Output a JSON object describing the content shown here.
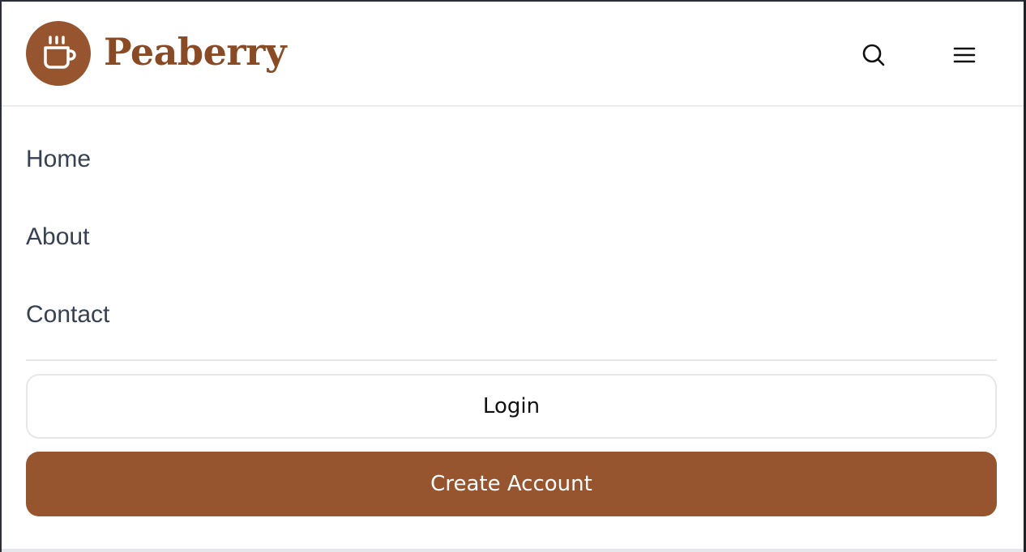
{
  "colors": {
    "brand": "#96552f",
    "brand_text": "#8a4a24",
    "nav_text": "#374151",
    "divider": "#e5e7eb"
  },
  "header": {
    "logo_icon": "coffee-cup-icon",
    "brand_name": "Peaberry",
    "search_icon": "search-icon",
    "menu_icon": "hamburger-menu-icon"
  },
  "menu": {
    "items": [
      {
        "label": "Home"
      },
      {
        "label": "About"
      },
      {
        "label": "Contact"
      }
    ],
    "login_label": "Login",
    "create_account_label": "Create Account"
  }
}
